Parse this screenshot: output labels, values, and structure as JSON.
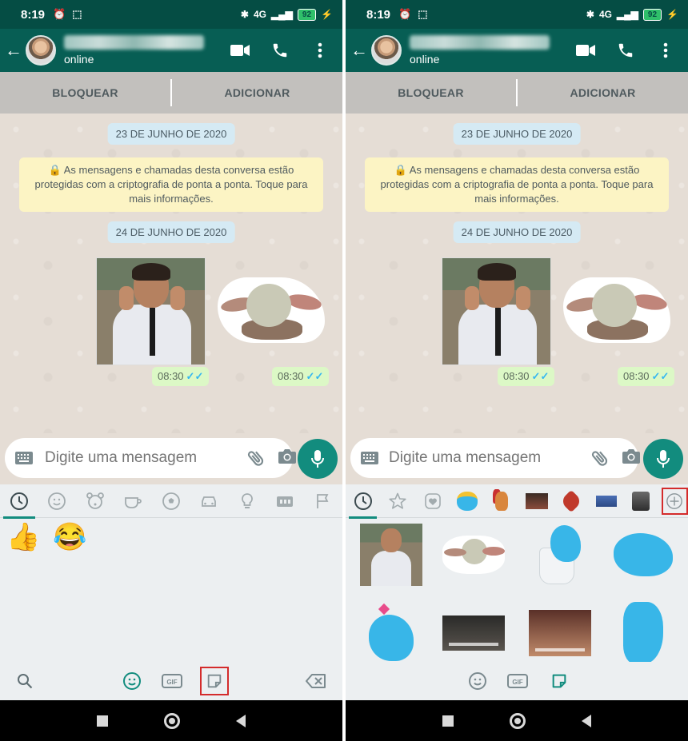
{
  "status_bar": {
    "time": "8:19",
    "battery": "92",
    "signal_label": "4G"
  },
  "header": {
    "contact_status": "online"
  },
  "block_bar": {
    "block_label": "BLOQUEAR",
    "add_label": "ADICIONAR"
  },
  "chat": {
    "date_1": "23 DE JUNHO DE 2020",
    "encryption_notice": "🔒 As mensagens e chamadas desta conversa estão protegidas com a criptografia de ponta a ponta. Toque para mais informações.",
    "date_2": "24 DE JUNHO DE 2020",
    "msg_1_time": "08:30",
    "msg_2_time": "08:30",
    "ticks": "✓✓"
  },
  "input": {
    "placeholder": "Digite uma mensagem"
  },
  "emoji_panel": {
    "recent_emojis": [
      "👍",
      "😂"
    ],
    "gif_label": "GIF"
  },
  "icons": {
    "back": "arrow-left",
    "video": "video-camera",
    "call": "phone",
    "menu": "dots-vertical",
    "keyboard": "keyboard",
    "attach": "paperclip",
    "camera": "camera",
    "mic": "microphone"
  },
  "colors": {
    "status_bar": "#054d44",
    "header": "#075e54",
    "accent": "#128c7e",
    "sent_bubble": "#dcf8c6",
    "date_pill": "#d5eaf4",
    "encryption_notice": "#fcf4c4",
    "highlight": "#d42b2b"
  }
}
